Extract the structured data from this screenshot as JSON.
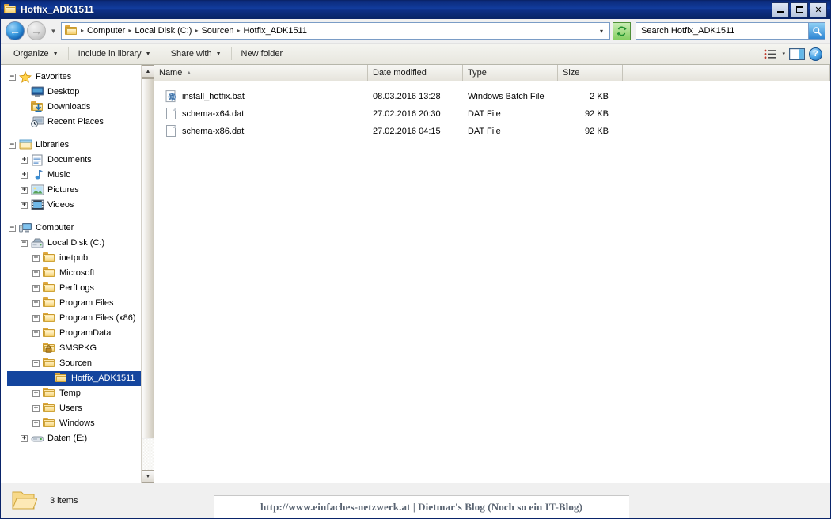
{
  "window": {
    "title": "Hotfix_ADK1511",
    "icon": "folder-icon",
    "controls": {
      "minimize": "minimize-icon",
      "maximize": "maximize-icon",
      "close": "close-icon"
    }
  },
  "address_bar": {
    "back": "back-arrow-icon",
    "forward": "forward-arrow-icon",
    "recent_dropdown": "chevron-down-icon",
    "breadcrumbs": [
      "Computer",
      "Local Disk (C:)",
      "Sourcen",
      "Hotfix_ADK1511"
    ],
    "separator": "▸",
    "dropdown_caret": "▾",
    "refresh": "refresh-icon",
    "search": {
      "placeholder": "Search Hotfix_ADK1511",
      "value": "",
      "button_icon": "search-icon"
    }
  },
  "toolbar": {
    "items": [
      {
        "label": "Organize",
        "has_caret": true
      },
      {
        "label": "Include in library",
        "has_caret": true
      },
      {
        "label": "Share with",
        "has_caret": true
      },
      {
        "label": "New folder",
        "has_caret": false
      }
    ],
    "view_icon": "list-view-icon",
    "view_caret": "▾",
    "preview_pane_icon": "preview-pane-icon",
    "help_icon": "help-icon",
    "help_label": "?"
  },
  "nav_pane": {
    "scrollbar": {
      "up": "▲",
      "down": "▼"
    },
    "tree": [
      {
        "label": "Favorites",
        "indent": 0,
        "expander": "minus",
        "icon": "star-icon",
        "selected": false
      },
      {
        "label": "Desktop",
        "indent": 1,
        "expander": "none",
        "icon": "desktop-icon",
        "selected": false
      },
      {
        "label": "Downloads",
        "indent": 1,
        "expander": "none",
        "icon": "downloads-icon",
        "selected": false
      },
      {
        "label": "Recent Places",
        "indent": 1,
        "expander": "none",
        "icon": "recent-places-icon",
        "selected": false
      },
      {
        "label": "",
        "indent": 0,
        "expander": "spacer",
        "icon": "none",
        "selected": false
      },
      {
        "label": "Libraries",
        "indent": 0,
        "expander": "minus",
        "icon": "libraries-icon",
        "selected": false
      },
      {
        "label": "Documents",
        "indent": 1,
        "expander": "plus",
        "icon": "documents-icon",
        "selected": false
      },
      {
        "label": "Music",
        "indent": 1,
        "expander": "plus",
        "icon": "music-icon",
        "selected": false
      },
      {
        "label": "Pictures",
        "indent": 1,
        "expander": "plus",
        "icon": "pictures-icon",
        "selected": false
      },
      {
        "label": "Videos",
        "indent": 1,
        "expander": "plus",
        "icon": "videos-icon",
        "selected": false
      },
      {
        "label": "",
        "indent": 0,
        "expander": "spacer",
        "icon": "none",
        "selected": false
      },
      {
        "label": "Computer",
        "indent": 0,
        "expander": "minus",
        "icon": "computer-icon",
        "selected": false
      },
      {
        "label": "Local Disk (C:)",
        "indent": 1,
        "expander": "minus",
        "icon": "harddisk-icon",
        "selected": false
      },
      {
        "label": "inetpub",
        "indent": 2,
        "expander": "plus",
        "icon": "folder-icon",
        "selected": false
      },
      {
        "label": "Microsoft",
        "indent": 2,
        "expander": "plus",
        "icon": "folder-icon",
        "selected": false
      },
      {
        "label": "PerfLogs",
        "indent": 2,
        "expander": "plus",
        "icon": "folder-icon",
        "selected": false
      },
      {
        "label": "Program Files",
        "indent": 2,
        "expander": "plus",
        "icon": "folder-icon",
        "selected": false
      },
      {
        "label": "Program Files (x86)",
        "indent": 2,
        "expander": "plus",
        "icon": "folder-icon",
        "selected": false
      },
      {
        "label": "ProgramData",
        "indent": 2,
        "expander": "plus",
        "icon": "folder-icon",
        "selected": false
      },
      {
        "label": "SMSPKG",
        "indent": 2,
        "expander": "none",
        "icon": "locked-folder-icon",
        "selected": false
      },
      {
        "label": "Sourcen",
        "indent": 2,
        "expander": "minus",
        "icon": "folder-icon",
        "selected": false
      },
      {
        "label": "Hotfix_ADK1511",
        "indent": 3,
        "expander": "none",
        "icon": "folder-icon",
        "selected": true
      },
      {
        "label": "Temp",
        "indent": 2,
        "expander": "plus",
        "icon": "folder-icon",
        "selected": false
      },
      {
        "label": "Users",
        "indent": 2,
        "expander": "plus",
        "icon": "folder-icon",
        "selected": false
      },
      {
        "label": "Windows",
        "indent": 2,
        "expander": "plus",
        "icon": "folder-icon",
        "selected": false
      },
      {
        "label": "Daten (E:)",
        "indent": 1,
        "expander": "plus",
        "icon": "drive-icon",
        "selected": false
      }
    ]
  },
  "file_list": {
    "columns": [
      {
        "key": "name",
        "label": "Name",
        "sorted": true,
        "sort_arrow": "▲"
      },
      {
        "key": "date",
        "label": "Date modified",
        "sorted": false
      },
      {
        "key": "type",
        "label": "Type",
        "sorted": false
      },
      {
        "key": "size",
        "label": "Size",
        "sorted": false
      }
    ],
    "rows": [
      {
        "name": "install_hotfix.bat",
        "date": "08.03.2016 13:28",
        "type": "Windows Batch File",
        "size": "2 KB",
        "icon": "batch-file-icon"
      },
      {
        "name": "schema-x64.dat",
        "date": "27.02.2016 20:30",
        "type": "DAT File",
        "size": "92 KB",
        "icon": "generic-file-icon"
      },
      {
        "name": "schema-x86.dat",
        "date": "27.02.2016 04:15",
        "type": "DAT File",
        "size": "92 KB",
        "icon": "generic-file-icon"
      }
    ]
  },
  "status_bar": {
    "icon": "open-folder-icon",
    "item_count": "3 items"
  },
  "watermark": {
    "text": "http://www.einfaches-netzwerk.at | Dietmar's Blog (Noch so ein IT-Blog)"
  },
  "colors": {
    "titlebar": "#0d2f86",
    "selection": "#14459e",
    "accent_blue": "#1763ab",
    "folder_yellow": "#f0c14b",
    "refresh_green": "#86cf62"
  }
}
